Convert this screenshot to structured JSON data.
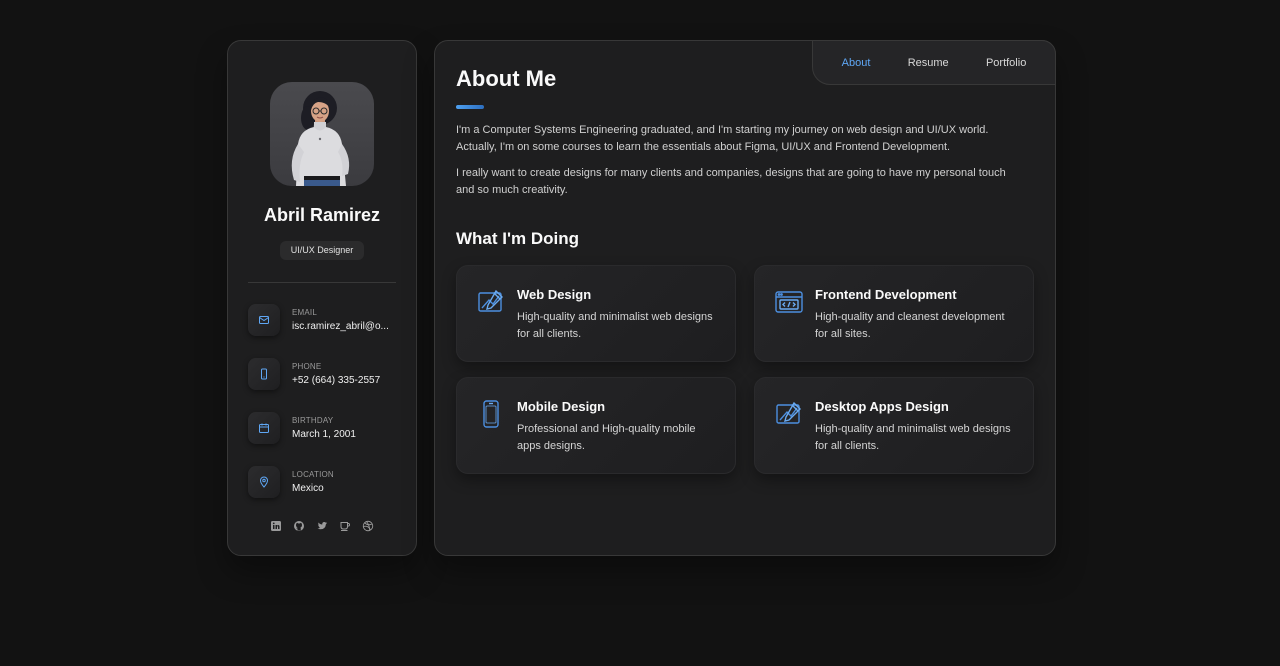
{
  "profile": {
    "name": "Abril Ramirez",
    "title": "UI/UX Designer",
    "contacts": [
      {
        "label": "Email",
        "value": "isc.ramirez_abril@o...",
        "icon": "mail-icon"
      },
      {
        "label": "Phone",
        "value": "+52 (664) 335-2557",
        "icon": "phone-icon"
      },
      {
        "label": "Birthday",
        "value": "March 1, 2001",
        "icon": "calendar-icon"
      },
      {
        "label": "Location",
        "value": "Mexico",
        "icon": "location-pin-icon"
      }
    ],
    "socials": [
      "linkedin-icon",
      "github-icon",
      "twitter-icon",
      "coffee-icon",
      "dribbble-icon"
    ]
  },
  "nav": {
    "items": [
      {
        "label": "About",
        "active": true
      },
      {
        "label": "Resume",
        "active": false
      },
      {
        "label": "Portfolio",
        "active": false
      }
    ]
  },
  "about": {
    "title": "About Me",
    "paragraphs": [
      "I'm a Computer Systems Engineering graduated, and I'm starting my journey on web design and UI/UX world. Actually, I'm on some courses to learn the essentials about Figma, UI/UX and Frontend Development.",
      "I really want to create designs for many clients and companies, designs that are going to have my personal touch and so much creativity."
    ],
    "services_title": "What I'm Doing",
    "services": [
      {
        "title": "Web Design",
        "description": "High-quality and minimalist web designs for all clients.",
        "icon": "web-design-icon"
      },
      {
        "title": "Frontend Development",
        "description": "High-quality and cleanest development for all sites.",
        "icon": "code-window-icon"
      },
      {
        "title": "Mobile Design",
        "description": "Professional and High-quality mobile apps designs.",
        "icon": "mobile-icon"
      },
      {
        "title": "Desktop Apps Design",
        "description": "High-quality and minimalist web designs for all clients.",
        "icon": "desktop-design-icon"
      }
    ]
  },
  "colors": {
    "accent": "#5fa7f5",
    "background": "#121212",
    "panel": "#1e1e1f"
  }
}
